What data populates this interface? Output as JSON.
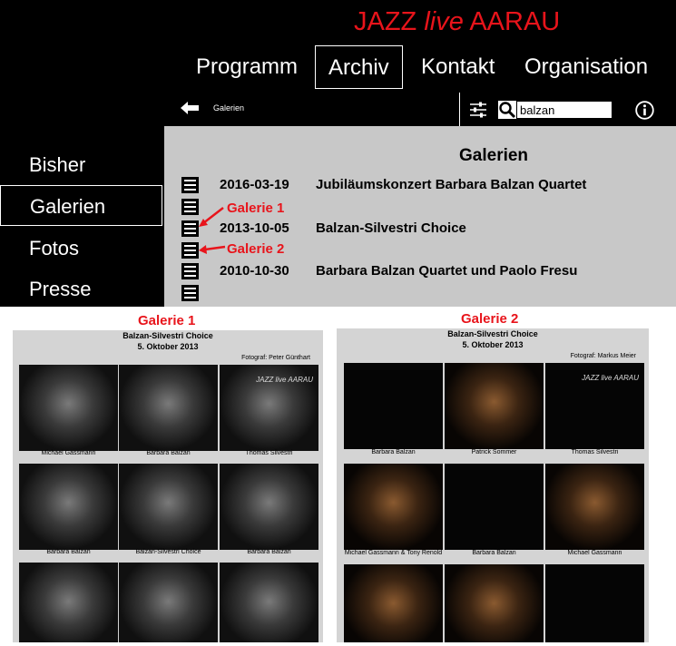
{
  "site_title": {
    "part1": "JAZZ ",
    "part2": "live",
    "part3": " AARAU"
  },
  "nav": [
    "Programm",
    "Archiv",
    "Kontakt",
    "Organisation"
  ],
  "toolbar": {
    "crumb": "Galerien",
    "search_value": "balzan"
  },
  "sidebar": [
    "Bisher",
    "Galerien",
    "Fotos",
    "Presse"
  ],
  "main": {
    "title": "Galerien",
    "rows": [
      {
        "date": "2016-03-19",
        "title": "Jubiläumskonzert Barbara Balzan Quartet"
      },
      {
        "date": "2013-10-05",
        "title": "Balzan-Silvestri Choice"
      },
      {
        "date": "2010-10-30",
        "title": "Barbara Balzan Quartet und Paolo Fresu"
      }
    ],
    "callouts": [
      "Galerie 1",
      "Galerie 2"
    ]
  },
  "previews": [
    {
      "label": "Galerie 1",
      "title": "Balzan-Silvestri Choice",
      "date": "5. Oktober 2013",
      "photographer": "Fotograf: Peter Günthart",
      "photo_text": "JAZZ live AARAU",
      "captions": [
        "Michael Gassmann",
        "Barbara Balzan",
        "Thomas Silvestri",
        "Barbara Balzan",
        "Balzan-Silvestri Choice",
        "Barbara Balzan"
      ]
    },
    {
      "label": "Galerie 2",
      "title": "Balzan-Silvestri Choice",
      "date": "5. Oktober 2013",
      "photographer": "Fotograf: Markus Meier",
      "photo_text": "JAZZ live AARAU",
      "captions": [
        "Barbara Balzan",
        "Patrick Sommer",
        "Thomas Silvestri",
        "Michael Gassmann & Tony Renold",
        "Barbara Balzan",
        "Michael Gassmann"
      ]
    }
  ],
  "colors": {
    "accent": "#e8141b",
    "header_bg": "#000000",
    "panel_bg": "#c8c8c8"
  }
}
